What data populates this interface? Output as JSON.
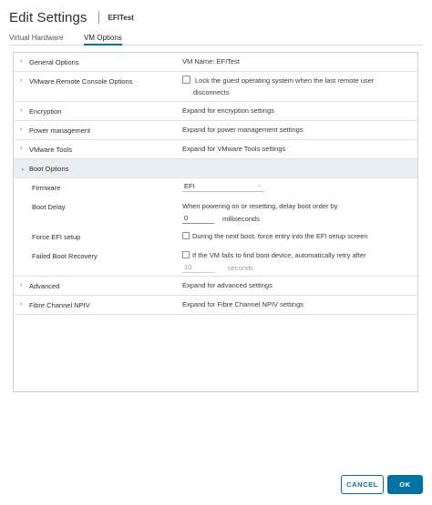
{
  "dialog": {
    "title": "Edit Settings",
    "vm_name": "EFITest"
  },
  "tabs": [
    {
      "label": "Virtual Hardware",
      "active": false
    },
    {
      "label": "VM Options",
      "active": true
    }
  ],
  "sections": {
    "general": {
      "label": "General Options",
      "value": "VM Name: EFITest"
    },
    "vmrc": {
      "label": "VMware Remote Console Options",
      "value_line1": "Lock the guest operating system when the last remote user",
      "value_line2": "disconnects",
      "checked": false
    },
    "encryption": {
      "label": "Encryption",
      "value": "Expand for encryption settings"
    },
    "power": {
      "label": "Power management",
      "value": "Expand for power management settings"
    },
    "tools": {
      "label": "VMware Tools",
      "value": "Expand for VMware Tools settings"
    },
    "boot": {
      "label": "Boot Options",
      "firmware": {
        "label": "Firmware",
        "value": "EFI"
      },
      "boot_delay": {
        "label": "Boot Delay",
        "text": "When powering on or resetting, delay boot order by",
        "value": "0",
        "unit": "milliseconds"
      },
      "force_efi": {
        "label": "Force EFI setup",
        "text": "During the next boot, force entry into the EFI setup screen",
        "checked": false
      },
      "failed_recovery": {
        "label": "Failed Boot Recovery",
        "text": "If the VM fails to find boot device, automatically retry after",
        "value": "10",
        "unit": "seconds",
        "checked": false
      }
    },
    "advanced": {
      "label": "Advanced",
      "value": "Expand for advanced settings"
    },
    "fc_npiv": {
      "label": "Fibre Channel NPIV",
      "value": "Expand for Fibre Channel NPIV settings"
    }
  },
  "buttons": {
    "cancel": "CANCEL",
    "ok": "OK"
  },
  "icons": {
    "collapsed": "chevron-right-icon",
    "expanded": "chevron-down-icon"
  },
  "colors": {
    "accent": "#0072a3",
    "section_highlight": "#e9eef2"
  }
}
